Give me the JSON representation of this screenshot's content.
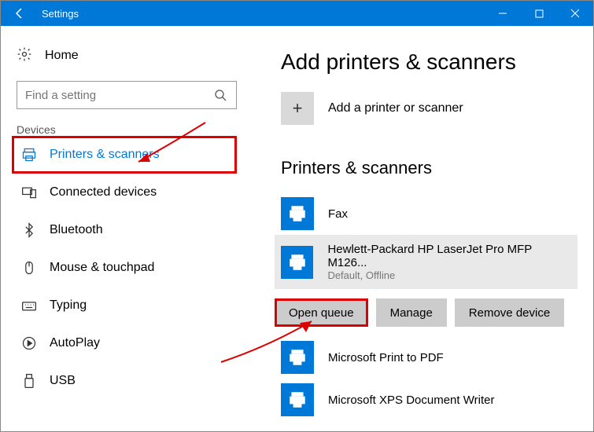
{
  "titlebar": {
    "title": "Settings"
  },
  "sidebar": {
    "home": "Home",
    "search_placeholder": "Find a setting",
    "category": "Devices",
    "items": [
      {
        "label": "Printers & scanners"
      },
      {
        "label": "Connected devices"
      },
      {
        "label": "Bluetooth"
      },
      {
        "label": "Mouse & touchpad"
      },
      {
        "label": "Typing"
      },
      {
        "label": "AutoPlay"
      },
      {
        "label": "USB"
      }
    ]
  },
  "main": {
    "heading_add": "Add printers & scanners",
    "add_label": "Add a printer or scanner",
    "heading_list": "Printers & scanners",
    "printers": [
      {
        "name": "Fax",
        "status": ""
      },
      {
        "name": "Hewlett-Packard HP LaserJet Pro MFP M126...",
        "status": "Default, Offline"
      },
      {
        "name": "Microsoft Print to PDF",
        "status": ""
      },
      {
        "name": "Microsoft XPS Document Writer",
        "status": ""
      }
    ],
    "actions": {
      "open_queue": "Open queue",
      "manage": "Manage",
      "remove": "Remove device"
    }
  }
}
